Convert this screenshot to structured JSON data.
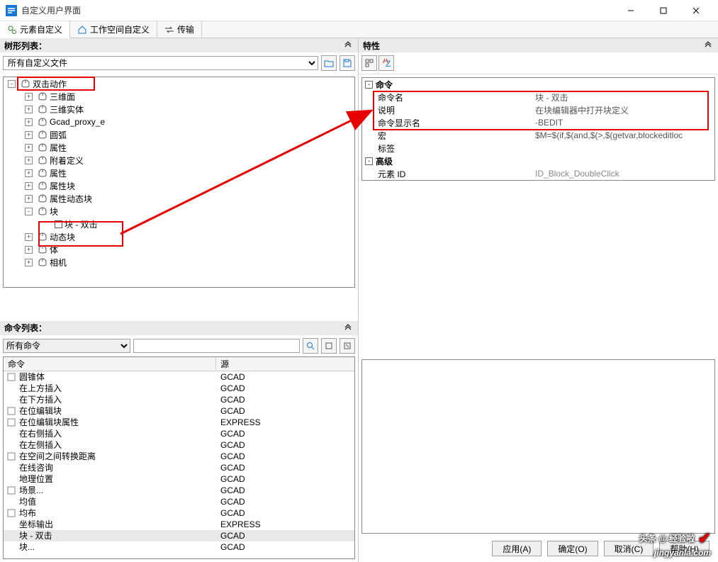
{
  "window": {
    "title": "自定义用户界面"
  },
  "tabs": [
    {
      "label": "元素自定义",
      "active": true
    },
    {
      "label": "工作空间自定义",
      "active": false
    },
    {
      "label": "传输",
      "active": false
    }
  ],
  "tree_panel": {
    "title": "树形列表：",
    "filter": "所有自定义文件",
    "nodes": [
      {
        "level": 1,
        "toggle": "-",
        "icon": "mouse",
        "label": "双击动作"
      },
      {
        "level": 2,
        "toggle": "+",
        "icon": "mouse",
        "label": "三维面"
      },
      {
        "level": 2,
        "toggle": "+",
        "icon": "mouse",
        "label": "三维实体"
      },
      {
        "level": 2,
        "toggle": "+",
        "icon": "mouse",
        "label": "Gcad_proxy_e"
      },
      {
        "level": 2,
        "toggle": "+",
        "icon": "mouse",
        "label": "圆弧"
      },
      {
        "level": 2,
        "toggle": "+",
        "icon": "mouse",
        "label": "属性"
      },
      {
        "level": 2,
        "toggle": "+",
        "icon": "mouse",
        "label": "附着定义"
      },
      {
        "level": 2,
        "toggle": "+",
        "icon": "mouse",
        "label": "属性"
      },
      {
        "level": 2,
        "toggle": "+",
        "icon": "mouse",
        "label": "属性块"
      },
      {
        "level": 2,
        "toggle": "+",
        "icon": "mouse",
        "label": "属性动态块"
      },
      {
        "level": 2,
        "toggle": "-",
        "icon": "mouse",
        "label": "块"
      },
      {
        "level": 3,
        "toggle": "",
        "icon": "sq",
        "label": "块 - 双击"
      },
      {
        "level": 2,
        "toggle": "+",
        "icon": "mouse",
        "label": "动态块"
      },
      {
        "level": 2,
        "toggle": "+",
        "icon": "mouse",
        "label": "体"
      },
      {
        "level": 2,
        "toggle": "+",
        "icon": "mouse",
        "label": "相机"
      }
    ]
  },
  "cmd_panel": {
    "title": "命令列表：",
    "filter": "所有命令",
    "search_placeholder": "",
    "columns": {
      "name": "命令",
      "source": "源"
    },
    "rows": [
      {
        "name": "圆锥体",
        "source": "GCAD",
        "icon": "cone"
      },
      {
        "name": "在上方插入",
        "source": "GCAD",
        "icon": ""
      },
      {
        "name": "在下方插入",
        "source": "GCAD",
        "icon": ""
      },
      {
        "name": "在位编辑块",
        "source": "GCAD",
        "icon": "editblock"
      },
      {
        "name": "在位编辑块属性",
        "source": "EXPRESS",
        "icon": "editattr"
      },
      {
        "name": "在右侧插入",
        "source": "GCAD",
        "icon": ""
      },
      {
        "name": "在左侧插入",
        "source": "GCAD",
        "icon": ""
      },
      {
        "name": "在空间之间转换距离",
        "source": "GCAD",
        "icon": "convert"
      },
      {
        "name": "在线咨询",
        "source": "GCAD",
        "icon": ""
      },
      {
        "name": "地理位置",
        "source": "GCAD",
        "icon": ""
      },
      {
        "name": "场景...",
        "source": "GCAD",
        "icon": "scene"
      },
      {
        "name": "均值",
        "source": "GCAD",
        "icon": ""
      },
      {
        "name": "均布",
        "source": "GCAD",
        "icon": "dist"
      },
      {
        "name": "坐标输出",
        "source": "EXPRESS",
        "icon": ""
      },
      {
        "name": "块 - 双击",
        "source": "GCAD",
        "icon": "",
        "selected": true
      },
      {
        "name": "块...",
        "source": "GCAD",
        "icon": ""
      }
    ]
  },
  "prop_panel": {
    "title": "特性",
    "sections": [
      {
        "label": "命令",
        "rows": [
          {
            "k": "命令名",
            "v": "块 - 双击"
          },
          {
            "k": "说明",
            "v": "在块编辑器中打开块定义"
          },
          {
            "k": "命令显示名",
            "v": "-BEDIT"
          },
          {
            "k": "宏",
            "v": "$M=$(if,$(and,$(>,$(getvar,blockeditloc"
          },
          {
            "k": "标签",
            "v": ""
          }
        ]
      },
      {
        "label": "高级",
        "rows": [
          {
            "k": "元素 ID",
            "v": "ID_Block_DoubleClick",
            "dim": true
          }
        ]
      }
    ]
  },
  "footer": {
    "apply": "应用(A)",
    "ok": "确定(O)",
    "cancel": "取消(C)",
    "help": "帮助(H)"
  },
  "watermark": {
    "l1": "头条 @ 经验啦",
    "l2": "jingyanla.com"
  }
}
